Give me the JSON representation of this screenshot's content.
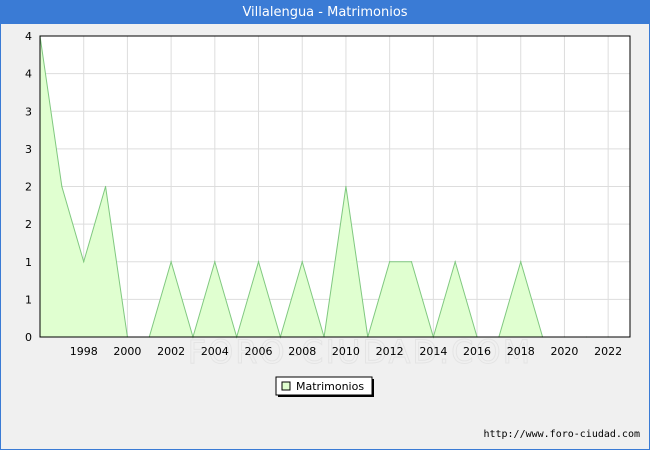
{
  "header": {
    "title": "Villalengua - Matrimonios"
  },
  "watermark": "FORO-CIUDAD.COM",
  "footer": {
    "url": "http://www.foro-ciudad.com"
  },
  "colors": {
    "title_bar": "#3a7bd5",
    "fill": "#e0ffd0",
    "line": "#80c880",
    "plot_bg": "#ffffff",
    "grid": "#dddddd"
  },
  "chart_data": {
    "type": "area",
    "title": "Villalengua - Matrimonios",
    "xlabel": "",
    "ylabel": "",
    "xlim": [
      1996,
      2023
    ],
    "ylim": [
      0,
      4
    ],
    "x_ticks": [
      "1998",
      "2000",
      "2002",
      "2004",
      "2006",
      "2008",
      "2010",
      "2012",
      "2014",
      "2016",
      "2018",
      "2020",
      "2022"
    ],
    "y_ticks": [
      "0",
      "1",
      "1",
      "2",
      "2",
      "3",
      "3",
      "4",
      "4"
    ],
    "grid": true,
    "legend_position": "bottom-center",
    "series": [
      {
        "name": "Matrimonios",
        "x": [
          1996,
          1997,
          1998,
          1999,
          2000,
          2001,
          2002,
          2003,
          2004,
          2005,
          2006,
          2007,
          2008,
          2009,
          2010,
          2011,
          2012,
          2013,
          2014,
          2015,
          2016,
          2017,
          2018,
          2019,
          2020,
          2021,
          2022
        ],
        "values": [
          4,
          2,
          1,
          2,
          0,
          0,
          1,
          0,
          1,
          0,
          1,
          0,
          1,
          0,
          2,
          0,
          1,
          1,
          0,
          1,
          0,
          0,
          1,
          0,
          0,
          0,
          0
        ]
      }
    ]
  }
}
